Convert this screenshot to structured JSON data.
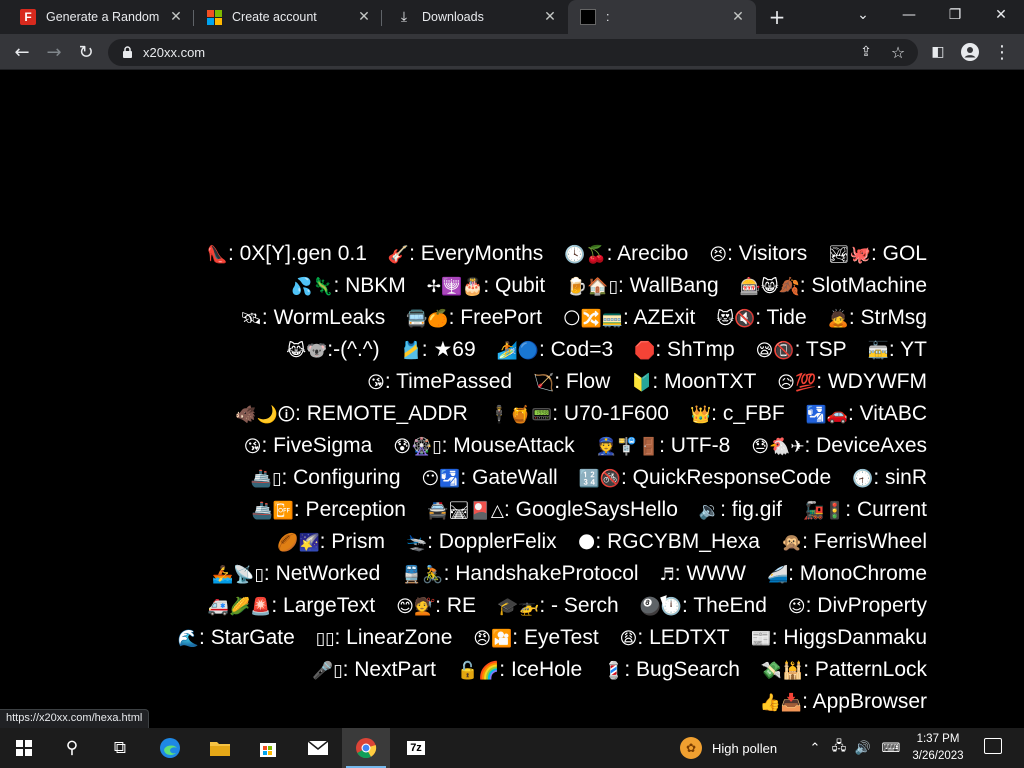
{
  "browser": {
    "tabs": [
      {
        "title": "Generate a Random Na",
        "favicon": "f-letter-icon",
        "active": false
      },
      {
        "title": "Create account",
        "favicon": "microsoft-logo-icon",
        "active": false
      },
      {
        "title": "Downloads",
        "favicon": "download-icon",
        "active": false
      },
      {
        "title": ":",
        "favicon": "black-square-icon",
        "active": true
      }
    ],
    "new_tab_label": "+",
    "url": "x20xx.com",
    "status_url": "https://x20xx.com/hexa.html"
  },
  "page": {
    "lines": [
      [
        {
          "emoji": "👠",
          "text": ": 0X[Y].gen 0.1"
        },
        {
          "emoji": "🎸",
          "text": ": EveryMonths"
        },
        {
          "emoji": "🕓🍒",
          "text": ": Arecibo"
        },
        {
          "emoji": "😣",
          "text": ": Visitors"
        },
        {
          "emoji": "🏞🐙",
          "text": ": GOL"
        }
      ],
      [
        {
          "emoji": "💦🦎",
          "text": ": NBKM"
        },
        {
          "emoji": "✢🕎🎂",
          "text": ": Qubit"
        },
        {
          "emoji": "🍺🏠▯",
          "text": ": WallBang"
        },
        {
          "emoji": "🎰😸🍂",
          "text": ": SlotMachine"
        }
      ],
      [
        {
          "emoji": "🛰",
          "text": ": WormLeaks"
        },
        {
          "emoji": "🚍🍊",
          "text": ": FreePort"
        },
        {
          "emoji": "🌕🔀🚃",
          "text": ": AZExit"
        },
        {
          "emoji": "😻🔇",
          "text": ": Tide"
        },
        {
          "emoji": "🙇",
          "text": ": StrMsg"
        }
      ],
      [
        {
          "emoji": "😹🐨",
          "text": ":-(^.^)"
        },
        {
          "emoji": "🎽",
          "text": ": ★69"
        },
        {
          "emoji": "🏄🔵",
          "text": ": Cod=3"
        },
        {
          "emoji": "🛑",
          "text": ": ShTmp"
        },
        {
          "emoji": "😪📵",
          "text": ": TSP"
        },
        {
          "emoji": "🚋",
          "text": ": YT"
        }
      ],
      [
        {
          "emoji": "😘",
          "text": ": TimePassed"
        },
        {
          "emoji": "🏹",
          "text": ": Flow"
        },
        {
          "emoji": "🔰",
          "text": ": MoonTXT"
        },
        {
          "emoji": "😥💯",
          "text": ": WDYWFM"
        }
      ],
      [
        {
          "emoji": "🐗🌙🛈",
          "text": ": REMOTE_ADDR"
        },
        {
          "emoji": "🕴🍯📟",
          "text": ": U70-1F600"
        },
        {
          "emoji": "👑",
          "text": ": c_FBF"
        },
        {
          "emoji": "🛂🚗",
          "text": ": VitABC"
        }
      ],
      [
        {
          "emoji": "😘",
          "text": ": FiveSigma"
        },
        {
          "emoji": "😰🎡▯",
          "text": ": MouseAttack"
        },
        {
          "emoji": "👮🚏🚪",
          "text": ": UTF-8"
        },
        {
          "emoji": "😓🐔✈",
          "text": ": DeviceAxes"
        }
      ],
      [
        {
          "emoji": "🚢▯",
          "text": ": Configuring"
        },
        {
          "emoji": "😶🛂",
          "text": ": GateWall"
        },
        {
          "emoji": "🔢🚳",
          "text": ": QuickResponseCode"
        },
        {
          "emoji": "🕣",
          "text": ": sinR"
        }
      ],
      [
        {
          "emoji": "🚢📴",
          "text": ": Perception"
        },
        {
          "emoji": "🚔🛤🎴△",
          "text": ": GoogleSaysHello"
        },
        {
          "emoji": "🔉",
          "text": ": fig.gif"
        },
        {
          "emoji": "🚂🚦",
          "text": ": Current"
        }
      ],
      [
        {
          "emoji": "🏉🌠",
          "text": ": Prism"
        },
        {
          "emoji": "🛬",
          "text": ": DopplerFelix"
        },
        {
          "emoji": "🌑",
          "text": ": RGCYBM_Hexa"
        },
        {
          "emoji": "🙊",
          "text": ": FerrisWheel"
        }
      ],
      [
        {
          "emoji": "🚣📡▯",
          "text": ": NetWorked"
        },
        {
          "emoji": "🚆🚴",
          "text": ": HandshakeProtocol"
        },
        {
          "emoji": "♬",
          "text": ": WWW"
        },
        {
          "emoji": "🚄",
          "text": ": MonoChrome"
        }
      ],
      [
        {
          "emoji": "🚑🌽🚨",
          "text": ": LargeText"
        },
        {
          "emoji": "😊💇",
          "text": ": RE"
        },
        {
          "emoji": "🎓🚁",
          "text": ": - Serch"
        },
        {
          "emoji": "🎱🕛",
          "text": ": TheEnd"
        },
        {
          "emoji": "😉",
          "text": ": DivProperty"
        }
      ],
      [
        {
          "emoji": "🌊",
          "text": ": StarGate"
        },
        {
          "emoji": "▯▯",
          "text": ": LinearZone"
        },
        {
          "emoji": "😠🎦",
          "text": ": EyeTest"
        },
        {
          "emoji": "😩",
          "text": ": LEDTXT"
        },
        {
          "emoji": "📰",
          "text": ": HiggsDanmaku"
        }
      ],
      [
        {
          "emoji": "🎤▯",
          "text": ": NextPart"
        },
        {
          "emoji": "🔓🌈",
          "text": ": IceHole"
        },
        {
          "emoji": "💈",
          "text": ": BugSearch"
        },
        {
          "emoji": "💸🕌",
          "text": ": PatternLock"
        }
      ],
      [
        {
          "emoji": "👍📥",
          "text": ": AppBrowser"
        }
      ]
    ]
  },
  "taskbar": {
    "apps": [
      "start-icon",
      "search-icon",
      "task-view-icon",
      "edge-icon",
      "file-explorer-icon",
      "store-icon",
      "mail-icon",
      "chrome-icon",
      "7zip-icon"
    ],
    "zip_label": "7z",
    "weather": "High pollen",
    "time": "1:37 PM",
    "date": "3/26/2023"
  }
}
